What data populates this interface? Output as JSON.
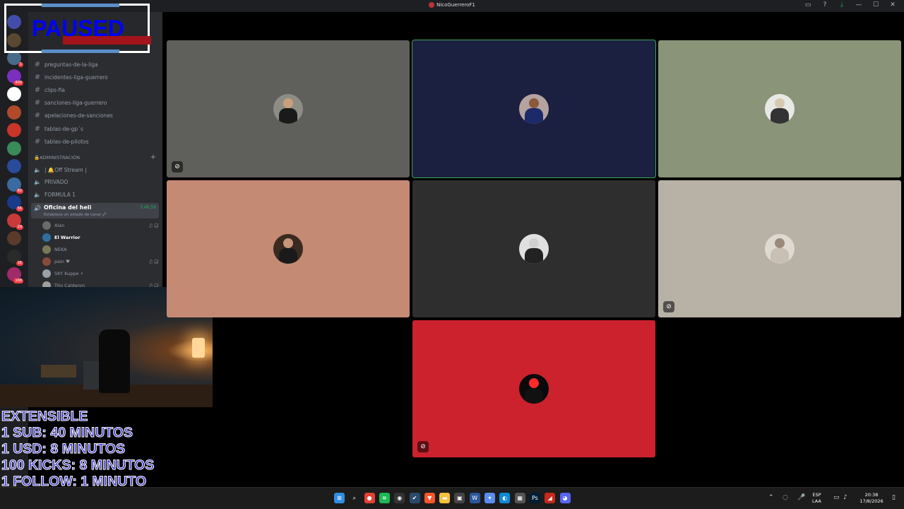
{
  "window": {
    "title": "NicoGuerreroF1"
  },
  "paused_overlay": {
    "text": "PAUSED"
  },
  "rail": {
    "servers": [
      {
        "color": "#5865f2",
        "badge": ""
      },
      {
        "color": "#7a5c3a",
        "badge": ""
      },
      {
        "color": "#4a6a8a",
        "badge": "1"
      },
      {
        "color": "#7b2fbe",
        "badge": "406"
      },
      {
        "color": "#ffffff",
        "badge": ""
      },
      {
        "color": "#b04a2a",
        "badge": ""
      },
      {
        "color": "#c8352a",
        "badge": ""
      },
      {
        "color": "#3a8a5a",
        "badge": ""
      },
      {
        "color": "#2a4a9a",
        "badge": ""
      },
      {
        "color": "#3a6aa0",
        "badge": "60"
      },
      {
        "color": "#1a3a8a",
        "badge": "56"
      },
      {
        "color": "#c83a3a",
        "badge": "29"
      },
      {
        "color": "#5a3a2a",
        "badge": ""
      },
      {
        "color": "#2a2a2a",
        "badge": "16"
      },
      {
        "color": "#a02a6a",
        "badge": "168"
      }
    ]
  },
  "sidebar": {
    "text_channels": [
      "preguntas-de-la-liga",
      "incidentes-liga-guerrero",
      "clips-fia",
      "sanciones-liga-guerrero",
      "apelaciones-de-sanciones",
      "tablas-de-gp´s",
      "tablas-de-pilotos"
    ],
    "category": "ADMINISTRACIÓN",
    "voice_channels": [
      "| 🔔Off Stream |",
      "PRIVADO",
      "FORMULA 1"
    ],
    "active": {
      "name": "Oficina del heli",
      "status": "Establece un estado de canal 🖉",
      "time": "3:46:59"
    },
    "voice_users": [
      {
        "name": "Alan",
        "icons": "🎙̸ 🎧̸",
        "bold": false,
        "color": "#6b6b6b"
      },
      {
        "name": "El Warrior",
        "icons": "",
        "bold": true,
        "color": "#2f6fa0"
      },
      {
        "name": "NEKA",
        "icons": "",
        "bold": false,
        "color": "#7a7a5a"
      },
      {
        "name": "pain ♥",
        "icons": "🎙̸ 🎧̸",
        "bold": false,
        "color": "#8a4a3a"
      },
      {
        "name": "SKY Kuppe ⚡",
        "icons": "",
        "bold": false,
        "color": "#9aa0a8"
      },
      {
        "name": "Tito Calderon",
        "icons": "🎙̸ 🎧̸",
        "bold": false,
        "color": "#a0a0a0"
      }
    ]
  },
  "stream_text": [
    "EXTENSIBLE",
    "1 SUB: 40 MINUTOS",
    "1 USD: 8 MINUTOS",
    "100 KICKS: 8 MINUTOS",
    "1 FOLLOW: 1 MINUTO"
  ],
  "tiles": [
    {
      "bg": "#5f5f5b",
      "head": "#c9a07a",
      "body": "#1a1a1a",
      "pfp_bg": "#8d8d86",
      "muted": true,
      "speaking": false
    },
    {
      "bg": "#1b2040",
      "head": "#8a5a3a",
      "body": "#1c2a6a",
      "pfp_bg": "#b5a3a0",
      "muted": false,
      "speaking": true
    },
    {
      "bg": "#8a9479",
      "head": "#d8c8b0",
      "body": "#333",
      "pfp_bg": "#e8e8e4",
      "muted": false,
      "speaking": false
    },
    {
      "bg": "#c48a73",
      "head": "#c8967a",
      "body": "#1a1a1a",
      "pfp_bg": "#3a2a20",
      "muted": false,
      "speaking": false
    },
    {
      "bg": "#2e2e2e",
      "head": "#cfcfcf",
      "body": "#222",
      "pfp_bg": "#e0e0e0",
      "muted": false,
      "speaking": false
    },
    {
      "bg": "#b8b1a6",
      "head": "#9a8a7a",
      "body": "#c8c0b4",
      "pfp_bg": "#dedad2",
      "muted": true,
      "speaking": false
    },
    {
      "bg": "#cb222e",
      "head": "#ff2a2a",
      "body": "#111",
      "pfp_bg": "#0a0a0a",
      "muted": true,
      "speaking": false
    }
  ],
  "taskbar": {
    "apps": [
      {
        "name": "start",
        "color": "#2f8de4",
        "glyph": "⊞"
      },
      {
        "name": "search",
        "color": "transparent",
        "glyph": "⌕"
      },
      {
        "name": "chrome",
        "color": "#e34133",
        "glyph": "●"
      },
      {
        "name": "spotify",
        "color": "#1db954",
        "glyph": "≋"
      },
      {
        "name": "obs",
        "color": "#333",
        "glyph": "◉"
      },
      {
        "name": "active-app",
        "color": "#2a4a6a",
        "glyph": "✔"
      },
      {
        "name": "brave",
        "color": "#fb542b",
        "glyph": "▼"
      },
      {
        "name": "explorer",
        "color": "#f3c13a",
        "glyph": "▬"
      },
      {
        "name": "app9",
        "color": "#444",
        "glyph": "▣"
      },
      {
        "name": "word",
        "color": "#2b579a",
        "glyph": "W"
      },
      {
        "name": "copilot",
        "color": "#5b8def",
        "glyph": "✦"
      },
      {
        "name": "edge",
        "color": "#0c8ad6",
        "glyph": "◐"
      },
      {
        "name": "app13",
        "color": "#555",
        "glyph": "▦"
      },
      {
        "name": "photoshop",
        "color": "#001e36",
        "glyph": "Ps"
      },
      {
        "name": "app15",
        "color": "#c42b1c",
        "glyph": "◢"
      },
      {
        "name": "discord",
        "color": "#5865f2",
        "glyph": "◕"
      }
    ],
    "lang_line1": "ESP",
    "lang_line2": "LAA",
    "time": "20:38",
    "date": "17/8/2026"
  }
}
